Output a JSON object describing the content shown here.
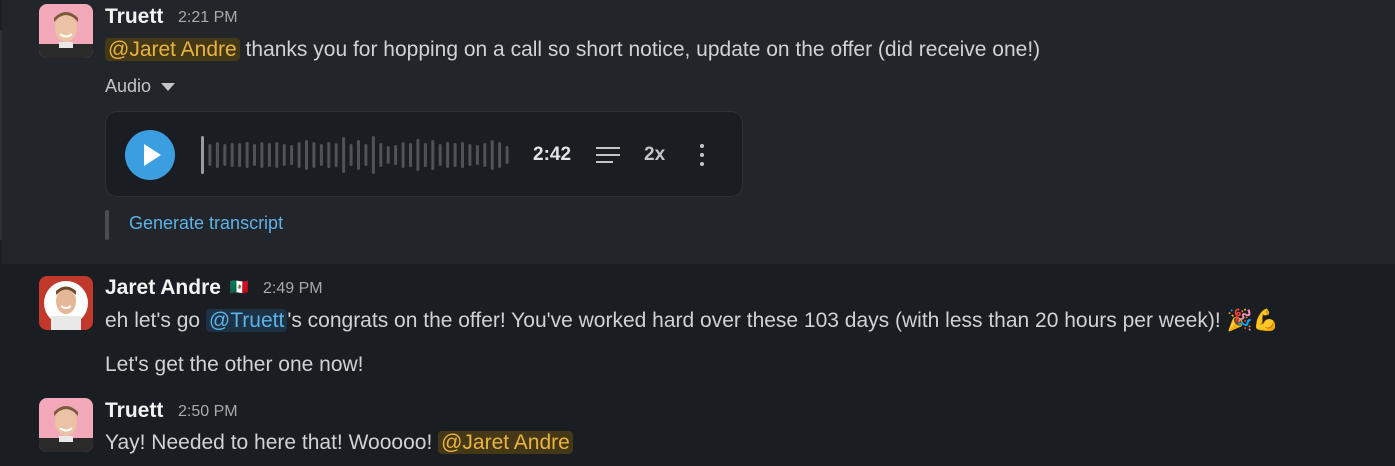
{
  "messages": [
    {
      "author": "Truett",
      "time": "2:21 PM",
      "mention": "@Jaret Andre",
      "text": " thanks you for hopping on a call so short notice, update on the offer (did receive one!)",
      "attachment": {
        "label": "Audio",
        "duration": "2:42",
        "speed": "2x",
        "action": "Generate transcript"
      }
    },
    {
      "author": "Jaret Andre",
      "flag": "🇲🇽",
      "time": "2:49 PM",
      "line1_prefix": "eh let's go ",
      "line1_mention": "@Truett",
      "line1_suffix": "'s congrats on the offer! You've worked hard over these 103 days (with less than 20 hours per week)! 🎉💪",
      "line2": "Let's get the other one now!"
    },
    {
      "author": "Truett",
      "time": "2:50 PM",
      "text": "Yay! Needed to here that! Wooooo! ",
      "mention": "@Jaret Andre"
    }
  ],
  "colors": {
    "background": "#1a1d21",
    "hover_row": "#222529",
    "mention_yellow": "#e8b33f",
    "mention_blue": "#5eb2e8",
    "play_button": "#3b9ee0"
  },
  "icons": [
    "play-icon",
    "caret-down-icon",
    "transcript-lines-icon",
    "more-vertical-icon"
  ]
}
